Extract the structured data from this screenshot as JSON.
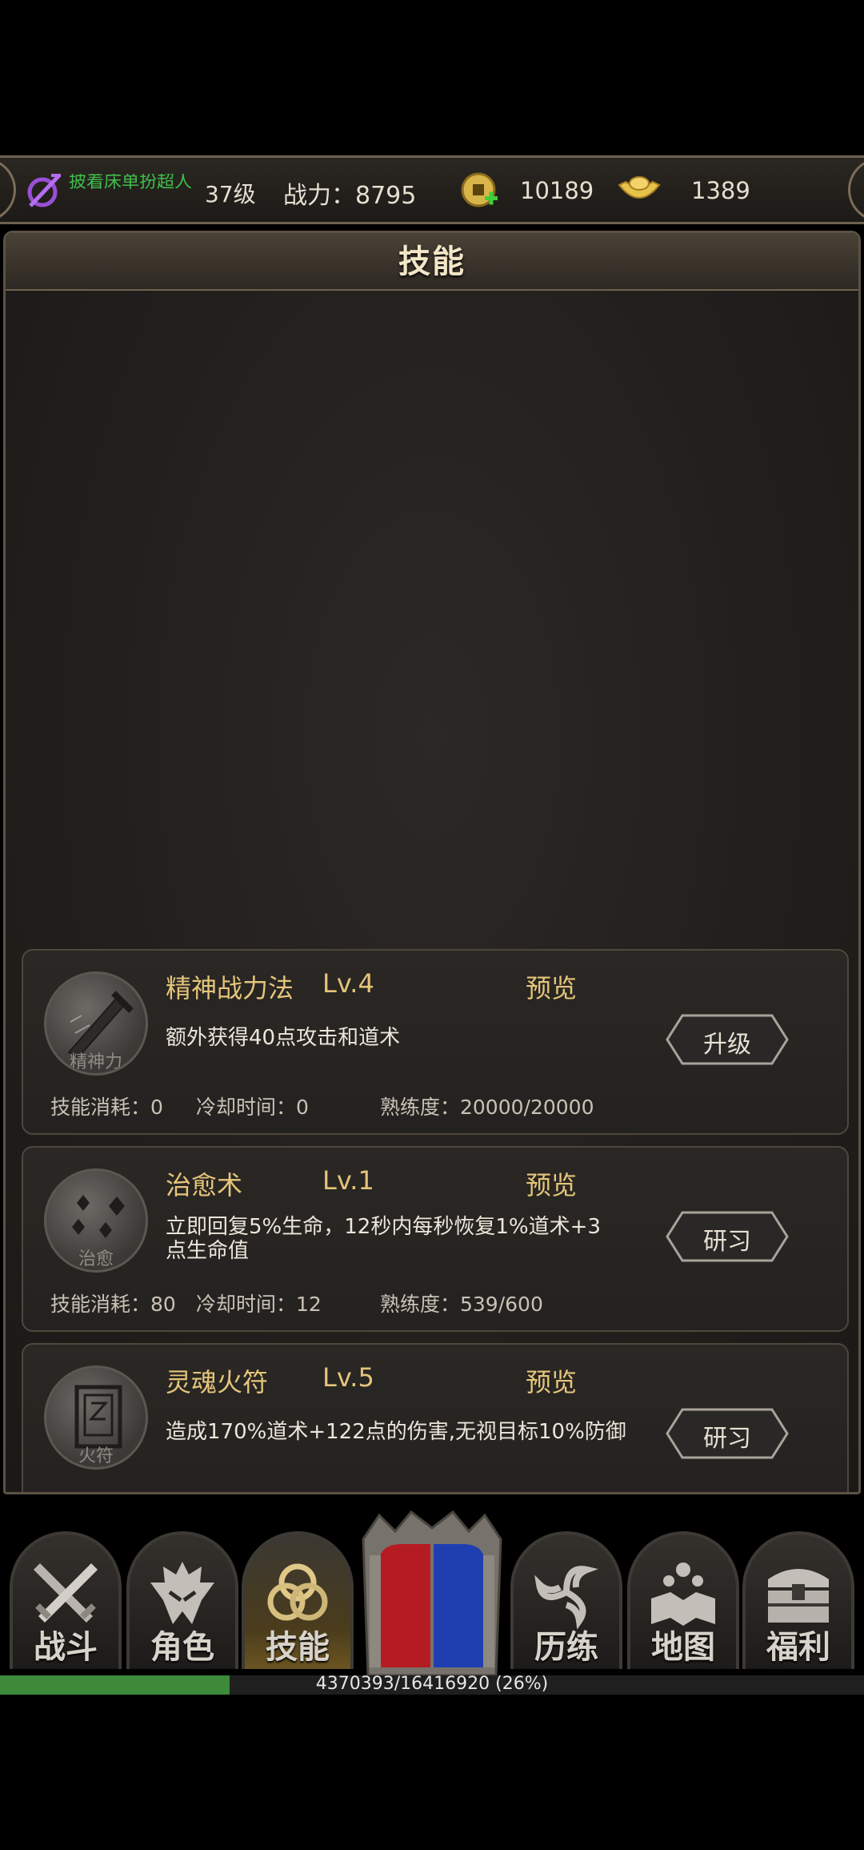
{
  "status_bar": {
    "player_name": "披着床单扮超人",
    "level": "37级",
    "power": "战力：8795",
    "coins": "10189",
    "ingots": "1389",
    "icons": [
      "guild-emblem-icon",
      "copper-coin-add-icon",
      "gold-ingot-icon"
    ]
  },
  "panel": {
    "title": "技能"
  },
  "skills": [
    {
      "name": "精神战力法",
      "level": "Lv.4",
      "preview": "预览",
      "description": "额外获得40点攻击和道术",
      "cost": "技能消耗：0",
      "cooldown": "冷却时间：0",
      "proficiency": "熟练度：20000/20000",
      "button": "升级",
      "icon_label": "精神力",
      "icon": "sword-skill-icon"
    },
    {
      "name": "治愈术",
      "level": "Lv.1",
      "preview": "预览",
      "description": "立即回复5%生命，12秒内每秒恢复1%道术+3点生命值",
      "cost": "技能消耗：80",
      "cooldown": "冷却时间：12",
      "proficiency": "熟练度：539/600",
      "button": "研习",
      "icon_label": "治愈",
      "icon": "heal-skill-icon"
    },
    {
      "name": "灵魂火符",
      "level": "Lv.5",
      "preview": "预览",
      "description": "造成170%道术+122点的伤害,无视目标10%防御",
      "button": "研习",
      "icon_label": "火符",
      "icon": "talisman-skill-icon"
    }
  ],
  "nav": [
    {
      "label": "战斗",
      "icon": "crossed-swords-icon"
    },
    {
      "label": "角色",
      "icon": "helmet-icon"
    },
    {
      "label": "技能",
      "icon": "triquetra-icon",
      "active": true
    },
    {
      "label": "历练",
      "icon": "triskelion-icon"
    },
    {
      "label": "地图",
      "icon": "map-icon"
    },
    {
      "label": "福利",
      "icon": "treasure-chest-icon"
    }
  ],
  "exp": {
    "text": "4370393/16416920 (26%)",
    "fraction": 0.266
  },
  "colors": {
    "accent_gold": "#e5c57a",
    "exp_green": "#3c8a3a",
    "name_green": "#3dbd4a"
  }
}
